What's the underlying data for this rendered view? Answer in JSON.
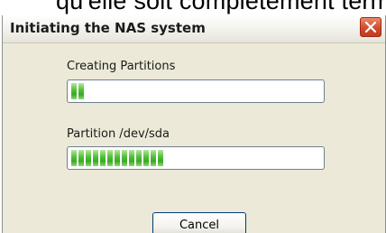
{
  "background": {
    "partial_text": "qu'elle soit complètement termi"
  },
  "dialog": {
    "title": "Initiating the NAS system",
    "close_icon": "close-icon"
  },
  "task_progress": {
    "label": "Creating Partitions",
    "filled_segments": 2,
    "fill_color": "#4cbb33"
  },
  "partition_progress": {
    "label": "Partition /dev/sda",
    "filled_segments": 13,
    "fill_color": "#4cbb33"
  },
  "buttons": {
    "cancel_label": "Cancel"
  },
  "colors": {
    "dialog_bg": "#ece9d8",
    "close_button": "#d34b2c",
    "button_border": "#003c74"
  }
}
